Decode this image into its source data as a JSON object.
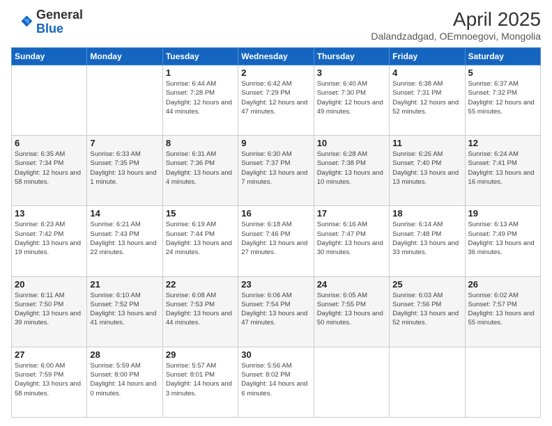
{
  "header": {
    "logo_general": "General",
    "logo_blue": "Blue",
    "title": "April 2025",
    "subtitle": "Dalandzadgad, OEmnoegovi, Mongolia"
  },
  "days_of_week": [
    "Sunday",
    "Monday",
    "Tuesday",
    "Wednesday",
    "Thursday",
    "Friday",
    "Saturday"
  ],
  "weeks": [
    [
      {
        "day": "",
        "info": ""
      },
      {
        "day": "",
        "info": ""
      },
      {
        "day": "1",
        "info": "Sunrise: 6:44 AM\nSunset: 7:28 PM\nDaylight: 12 hours and 44 minutes."
      },
      {
        "day": "2",
        "info": "Sunrise: 6:42 AM\nSunset: 7:29 PM\nDaylight: 12 hours and 47 minutes."
      },
      {
        "day": "3",
        "info": "Sunrise: 6:40 AM\nSunset: 7:30 PM\nDaylight: 12 hours and 49 minutes."
      },
      {
        "day": "4",
        "info": "Sunrise: 6:38 AM\nSunset: 7:31 PM\nDaylight: 12 hours and 52 minutes."
      },
      {
        "day": "5",
        "info": "Sunrise: 6:37 AM\nSunset: 7:32 PM\nDaylight: 12 hours and 55 minutes."
      }
    ],
    [
      {
        "day": "6",
        "info": "Sunrise: 6:35 AM\nSunset: 7:34 PM\nDaylight: 12 hours and 58 minutes."
      },
      {
        "day": "7",
        "info": "Sunrise: 6:33 AM\nSunset: 7:35 PM\nDaylight: 13 hours and 1 minute."
      },
      {
        "day": "8",
        "info": "Sunrise: 6:31 AM\nSunset: 7:36 PM\nDaylight: 13 hours and 4 minutes."
      },
      {
        "day": "9",
        "info": "Sunrise: 6:30 AM\nSunset: 7:37 PM\nDaylight: 13 hours and 7 minutes."
      },
      {
        "day": "10",
        "info": "Sunrise: 6:28 AM\nSunset: 7:38 PM\nDaylight: 13 hours and 10 minutes."
      },
      {
        "day": "11",
        "info": "Sunrise: 6:26 AM\nSunset: 7:40 PM\nDaylight: 13 hours and 13 minutes."
      },
      {
        "day": "12",
        "info": "Sunrise: 6:24 AM\nSunset: 7:41 PM\nDaylight: 13 hours and 16 minutes."
      }
    ],
    [
      {
        "day": "13",
        "info": "Sunrise: 6:23 AM\nSunset: 7:42 PM\nDaylight: 13 hours and 19 minutes."
      },
      {
        "day": "14",
        "info": "Sunrise: 6:21 AM\nSunset: 7:43 PM\nDaylight: 13 hours and 22 minutes."
      },
      {
        "day": "15",
        "info": "Sunrise: 6:19 AM\nSunset: 7:44 PM\nDaylight: 13 hours and 24 minutes."
      },
      {
        "day": "16",
        "info": "Sunrise: 6:18 AM\nSunset: 7:46 PM\nDaylight: 13 hours and 27 minutes."
      },
      {
        "day": "17",
        "info": "Sunrise: 6:16 AM\nSunset: 7:47 PM\nDaylight: 13 hours and 30 minutes."
      },
      {
        "day": "18",
        "info": "Sunrise: 6:14 AM\nSunset: 7:48 PM\nDaylight: 13 hours and 33 minutes."
      },
      {
        "day": "19",
        "info": "Sunrise: 6:13 AM\nSunset: 7:49 PM\nDaylight: 13 hours and 36 minutes."
      }
    ],
    [
      {
        "day": "20",
        "info": "Sunrise: 6:11 AM\nSunset: 7:50 PM\nDaylight: 13 hours and 39 minutes."
      },
      {
        "day": "21",
        "info": "Sunrise: 6:10 AM\nSunset: 7:52 PM\nDaylight: 13 hours and 41 minutes."
      },
      {
        "day": "22",
        "info": "Sunrise: 6:08 AM\nSunset: 7:53 PM\nDaylight: 13 hours and 44 minutes."
      },
      {
        "day": "23",
        "info": "Sunrise: 6:06 AM\nSunset: 7:54 PM\nDaylight: 13 hours and 47 minutes."
      },
      {
        "day": "24",
        "info": "Sunrise: 6:05 AM\nSunset: 7:55 PM\nDaylight: 13 hours and 50 minutes."
      },
      {
        "day": "25",
        "info": "Sunrise: 6:03 AM\nSunset: 7:56 PM\nDaylight: 13 hours and 52 minutes."
      },
      {
        "day": "26",
        "info": "Sunrise: 6:02 AM\nSunset: 7:57 PM\nDaylight: 13 hours and 55 minutes."
      }
    ],
    [
      {
        "day": "27",
        "info": "Sunrise: 6:00 AM\nSunset: 7:59 PM\nDaylight: 13 hours and 58 minutes."
      },
      {
        "day": "28",
        "info": "Sunrise: 5:59 AM\nSunset: 8:00 PM\nDaylight: 14 hours and 0 minutes."
      },
      {
        "day": "29",
        "info": "Sunrise: 5:57 AM\nSunset: 8:01 PM\nDaylight: 14 hours and 3 minutes."
      },
      {
        "day": "30",
        "info": "Sunrise: 5:56 AM\nSunset: 8:02 PM\nDaylight: 14 hours and 6 minutes."
      },
      {
        "day": "",
        "info": ""
      },
      {
        "day": "",
        "info": ""
      },
      {
        "day": "",
        "info": ""
      }
    ]
  ]
}
